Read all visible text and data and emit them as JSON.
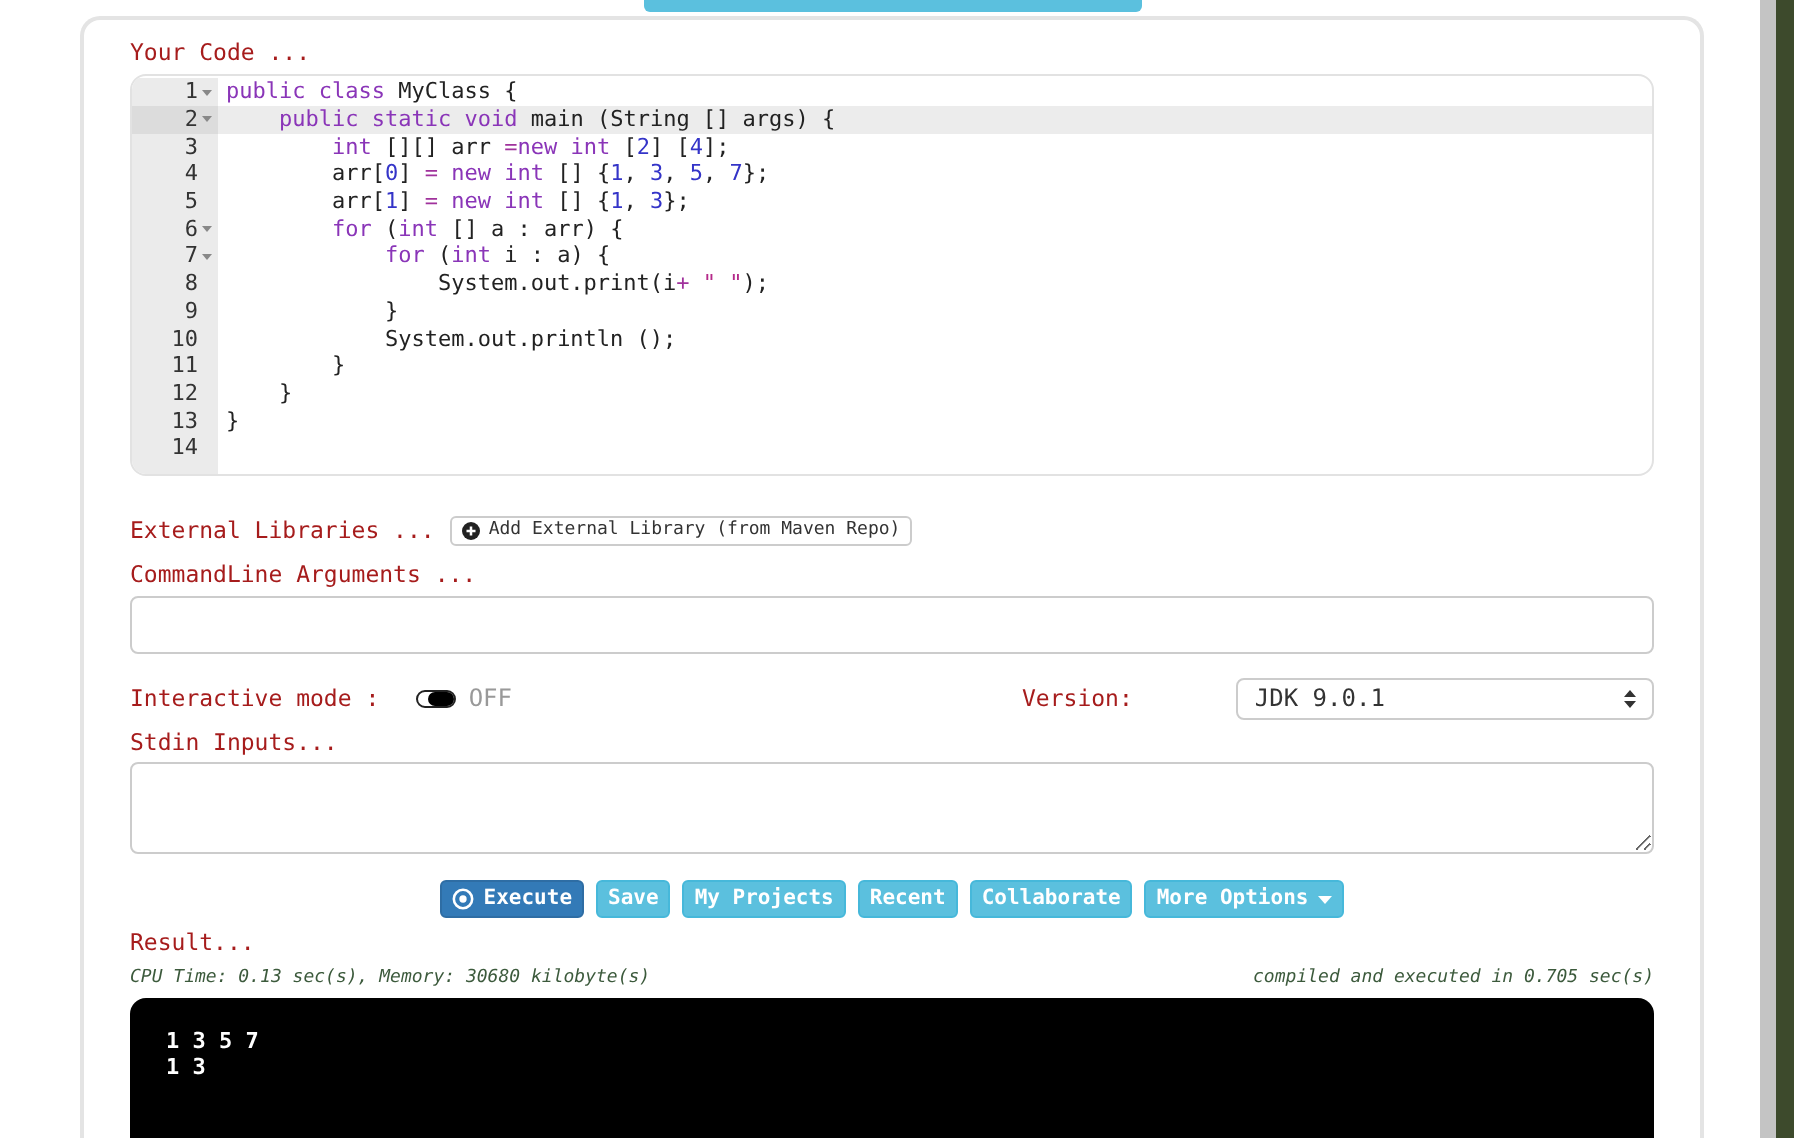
{
  "editor": {
    "label": "Your Code ...",
    "lines": [
      {
        "number": "1",
        "fold": true,
        "active": false,
        "tokens": [
          {
            "kind": "kw",
            "t": "public"
          },
          {
            "kind": "kw",
            "t": " class"
          },
          {
            "kind": "plain",
            "t": " MyClass {"
          }
        ]
      },
      {
        "number": "2",
        "fold": true,
        "active": true,
        "tokens": [
          {
            "kind": "kw",
            "t": "    public"
          },
          {
            "kind": "kw",
            "t": " static"
          },
          {
            "kind": "kw",
            "t": " void"
          },
          {
            "kind": "plain",
            "t": " main (String [] args) {"
          }
        ]
      },
      {
        "number": "3",
        "fold": false,
        "active": false,
        "tokens": [
          {
            "kind": "kw",
            "t": "        int"
          },
          {
            "kind": "plain",
            "t": " [][] arr "
          },
          {
            "kind": "op",
            "t": "="
          },
          {
            "kind": "kw",
            "t": "new"
          },
          {
            "kind": "kw",
            "t": " int"
          },
          {
            "kind": "plain",
            "t": " ["
          },
          {
            "kind": "num",
            "t": "2"
          },
          {
            "kind": "plain",
            "t": "] ["
          },
          {
            "kind": "num",
            "t": "4"
          },
          {
            "kind": "plain",
            "t": "];"
          }
        ]
      },
      {
        "number": "4",
        "fold": false,
        "active": false,
        "tokens": [
          {
            "kind": "plain",
            "t": "        arr["
          },
          {
            "kind": "num",
            "t": "0"
          },
          {
            "kind": "plain",
            "t": "] "
          },
          {
            "kind": "op",
            "t": "= "
          },
          {
            "kind": "kw",
            "t": "new"
          },
          {
            "kind": "kw",
            "t": " int"
          },
          {
            "kind": "plain",
            "t": " [] {"
          },
          {
            "kind": "num",
            "t": "1"
          },
          {
            "kind": "plain",
            "t": ", "
          },
          {
            "kind": "num",
            "t": "3"
          },
          {
            "kind": "plain",
            "t": ", "
          },
          {
            "kind": "num",
            "t": "5"
          },
          {
            "kind": "plain",
            "t": ", "
          },
          {
            "kind": "num",
            "t": "7"
          },
          {
            "kind": "plain",
            "t": "};"
          }
        ]
      },
      {
        "number": "5",
        "fold": false,
        "active": false,
        "tokens": [
          {
            "kind": "plain",
            "t": "        arr["
          },
          {
            "kind": "num",
            "t": "1"
          },
          {
            "kind": "plain",
            "t": "] "
          },
          {
            "kind": "op",
            "t": "= "
          },
          {
            "kind": "kw",
            "t": "new"
          },
          {
            "kind": "kw",
            "t": " int"
          },
          {
            "kind": "plain",
            "t": " [] {"
          },
          {
            "kind": "num",
            "t": "1"
          },
          {
            "kind": "plain",
            "t": ", "
          },
          {
            "kind": "num",
            "t": "3"
          },
          {
            "kind": "plain",
            "t": "};"
          }
        ]
      },
      {
        "number": "6",
        "fold": true,
        "active": false,
        "tokens": [
          {
            "kind": "kw",
            "t": "        for"
          },
          {
            "kind": "plain",
            "t": " ("
          },
          {
            "kind": "kw",
            "t": "int"
          },
          {
            "kind": "plain",
            "t": " [] a : arr) {"
          }
        ]
      },
      {
        "number": "7",
        "fold": true,
        "active": false,
        "tokens": [
          {
            "kind": "kw",
            "t": "            for"
          },
          {
            "kind": "plain",
            "t": " ("
          },
          {
            "kind": "kw",
            "t": "int"
          },
          {
            "kind": "plain",
            "t": " i : a) {"
          }
        ]
      },
      {
        "number": "8",
        "fold": false,
        "active": false,
        "tokens": [
          {
            "kind": "plain",
            "t": "                System.out.print(i"
          },
          {
            "kind": "op",
            "t": "+"
          },
          {
            "kind": "str",
            "t": " \" \""
          },
          {
            "kind": "plain",
            "t": ");"
          }
        ]
      },
      {
        "number": "9",
        "fold": false,
        "active": false,
        "tokens": [
          {
            "kind": "plain",
            "t": "            }"
          }
        ]
      },
      {
        "number": "10",
        "fold": false,
        "active": false,
        "tokens": [
          {
            "kind": "plain",
            "t": "            System.out.println ();"
          }
        ]
      },
      {
        "number": "11",
        "fold": false,
        "active": false,
        "tokens": [
          {
            "kind": "plain",
            "t": "        }"
          }
        ]
      },
      {
        "number": "12",
        "fold": false,
        "active": false,
        "tokens": [
          {
            "kind": "plain",
            "t": "    }"
          }
        ]
      },
      {
        "number": "13",
        "fold": false,
        "active": false,
        "tokens": [
          {
            "kind": "plain",
            "t": "}"
          }
        ]
      },
      {
        "number": "14",
        "fold": false,
        "active": false
      }
    ]
  },
  "external_libraries": {
    "label": "External Libraries ...",
    "button": "Add External Library (from Maven Repo)"
  },
  "commandline": {
    "label": "CommandLine Arguments ..."
  },
  "interactive_mode": {
    "label": "Interactive mode :",
    "on": false,
    "state_label": "OFF"
  },
  "version": {
    "label": "Version:",
    "value": "JDK 9.0.1"
  },
  "stdin": {
    "label": "Stdin Inputs..."
  },
  "buttons": [
    {
      "label": "Execute",
      "kind": "primary"
    },
    {
      "label": "Save",
      "kind": "info"
    },
    {
      "label": "My Projects",
      "kind": "info"
    },
    {
      "label": "Recent",
      "kind": "info"
    },
    {
      "label": "Collaborate",
      "kind": "info"
    },
    {
      "label": "More Options",
      "kind": "dropdown"
    }
  ],
  "result": {
    "label": "Result...",
    "stats": "CPU Time: 0.13 sec(s), Memory: 30680 kilobyte(s)",
    "timing": "compiled and executed in 0.705 sec(s)",
    "output": [
      "1 3 5 7",
      "1 3"
    ]
  }
}
